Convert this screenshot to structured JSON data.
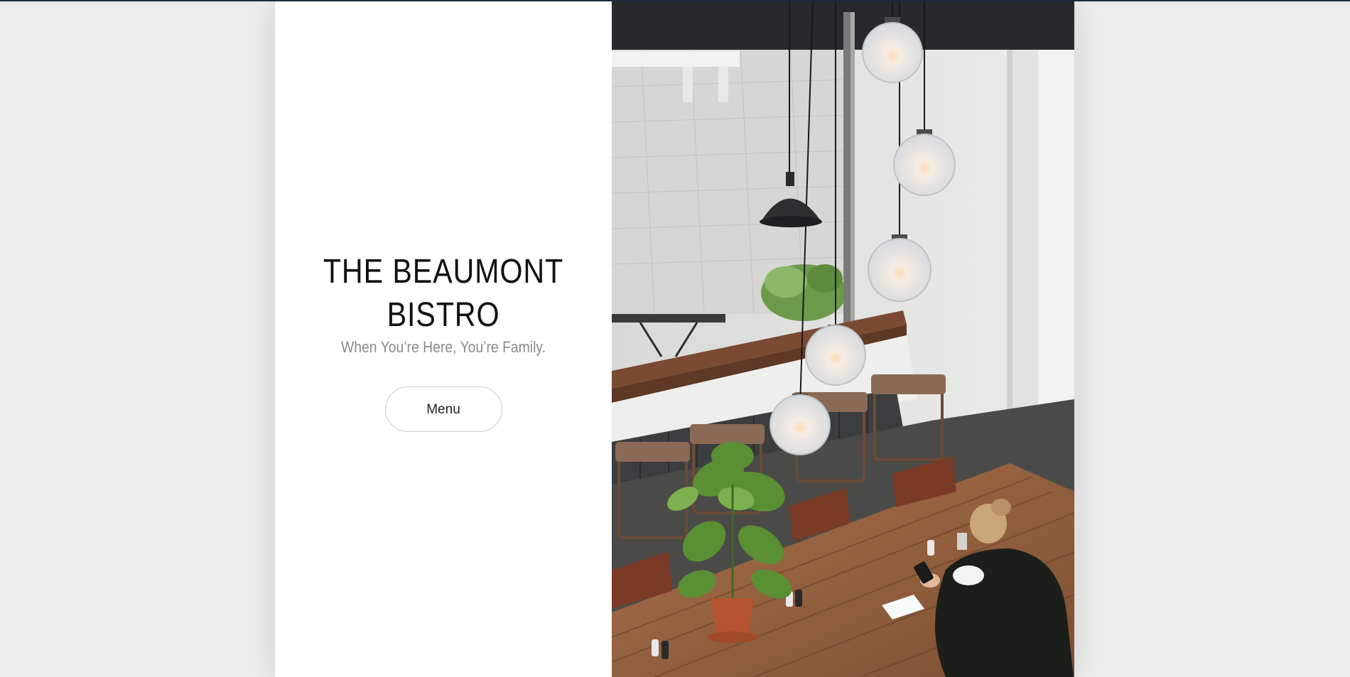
{
  "site": {
    "title_line1": "THE BEAUMONT",
    "title_line2": "BISTRO",
    "tagline": "When You’re Here, You’re Family.",
    "menu_button_label": "Menu"
  },
  "colors": {
    "page_background": "#ececec",
    "panel_background": "#ffffff",
    "title_text": "#111111",
    "tagline_text": "#8a8a8a",
    "top_line": "#1f2d3d"
  },
  "hero_image": {
    "subject": "restaurant interior photo"
  }
}
